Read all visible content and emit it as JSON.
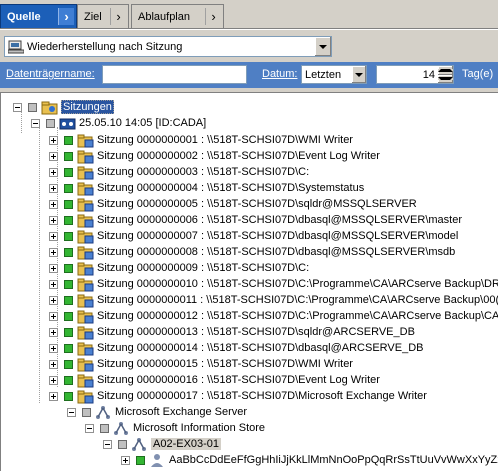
{
  "tabs": [
    {
      "label": "Quelle",
      "active": true
    },
    {
      "label": "Ziel",
      "active": false
    },
    {
      "label": "Ablaufplan",
      "active": false
    }
  ],
  "restore_mode": {
    "value": "Wiederherstellung nach Sitzung"
  },
  "filter": {
    "media_label": "Datenträgername:",
    "media_value": "",
    "date_label": "Datum:",
    "date_option": "Letzten",
    "days_value": "14",
    "days_unit": "Tag(e)"
  },
  "tree": {
    "root": "Sitzungen",
    "date_node": "25.05.10 14:05 [ID:CADA]",
    "sessions": [
      "Sitzung 0000000001 : \\\\518T-SCHSI07D\\WMI Writer",
      "Sitzung 0000000002 : \\\\518T-SCHSI07D\\Event Log Writer",
      "Sitzung 0000000003 : \\\\518T-SCHSI07D\\C:",
      "Sitzung 0000000004 : \\\\518T-SCHSI07D\\Systemstatus",
      "Sitzung 0000000005 : \\\\518T-SCHSI07D\\sqldr@MSSQLSERVER",
      "Sitzung 0000000006 : \\\\518T-SCHSI07D\\dbasql@MSSQLSERVER\\master",
      "Sitzung 0000000007 : \\\\518T-SCHSI07D\\dbasql@MSSQLSERVER\\model",
      "Sitzung 0000000008 : \\\\518T-SCHSI07D\\dbasql@MSSQLSERVER\\msdb",
      "Sitzung 0000000009 : \\\\518T-SCHSI07D\\C:",
      "Sitzung 0000000010 : \\\\518T-SCHSI07D\\C:\\Programme\\CA\\ARCserve Backup\\DR",
      "Sitzung 0000000011 : \\\\518T-SCHSI07D\\C:\\Programme\\CA\\ARCserve Backup\\00(",
      "Sitzung 0000000012 : \\\\518T-SCHSI07D\\C:\\Programme\\CA\\ARCserve Backup\\CA",
      "Sitzung 0000000013 : \\\\518T-SCHSI07D\\sqldr@ARCSERVE_DB",
      "Sitzung 0000000014 : \\\\518T-SCHSI07D\\dbasql@ARCSERVE_DB",
      "Sitzung 0000000015 : \\\\518T-SCHSI07D\\WMI Writer",
      "Sitzung 0000000016 : \\\\518T-SCHSI07D\\Event Log Writer",
      "Sitzung 0000000017 : \\\\518T-SCHSI07D\\Microsoft Exchange Writer"
    ],
    "exchange_server": "Microsoft Exchange Server",
    "info_store": "Microsoft Information Store",
    "server_node": "A02-EX03-01",
    "mailbox_node": "AaBbCcDdEeFfGgHhIiJjKkLlMmNnOoPpQqRrSsTtUuVvWwXxYyZz"
  }
}
